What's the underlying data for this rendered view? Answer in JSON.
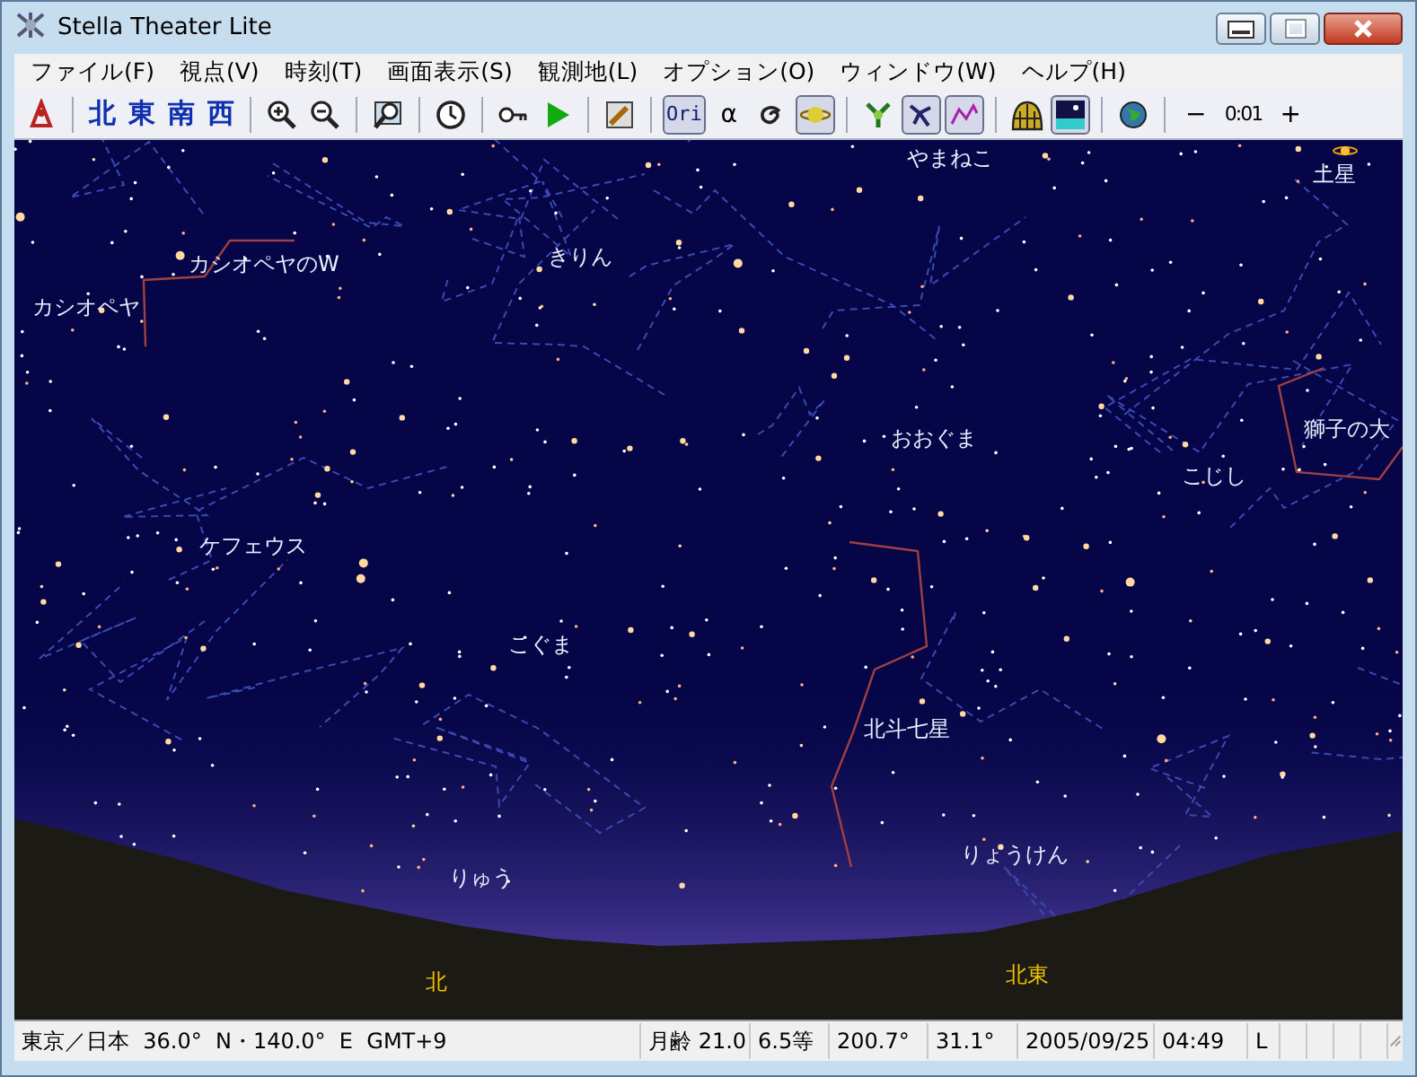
{
  "window": {
    "title": "Stella Theater Lite"
  },
  "menu": [
    "ファイル(F)",
    "視点(V)",
    "時刻(T)",
    "画面表示(S)",
    "観測地(L)",
    "オプション(O)",
    "ウィンドウ(W)",
    "ヘルプ(H)"
  ],
  "toolbar": [
    [
      {
        "kind": "tool",
        "pressed": false
      }
    ],
    [
      {
        "kind": "text",
        "label": "北",
        "pressed": false
      },
      {
        "kind": "text",
        "label": "東",
        "pressed": false
      },
      {
        "kind": "text",
        "label": "南",
        "pressed": false
      },
      {
        "kind": "text",
        "label": "西",
        "pressed": false
      }
    ],
    [
      {
        "kind": "tool",
        "pressed": false
      },
      {
        "kind": "tool",
        "pressed": false
      }
    ],
    [
      {
        "kind": "tool",
        "pressed": false
      }
    ],
    [
      {
        "kind": "tool",
        "pressed": false
      }
    ],
    [
      {
        "kind": "tool",
        "pressed": false
      },
      {
        "kind": "tool",
        "pressed": false
      }
    ],
    [
      {
        "kind": "tool",
        "pressed": false
      }
    ],
    [
      {
        "kind": "text",
        "label": "Ori",
        "pressed": true
      },
      {
        "kind": "text",
        "label": "α",
        "pressed": false
      },
      {
        "kind": "tool",
        "pressed": false
      },
      {
        "kind": "tool",
        "pressed": true
      }
    ],
    [
      {
        "kind": "tool",
        "pressed": false
      },
      {
        "kind": "tool",
        "pressed": true
      },
      {
        "kind": "tool",
        "pressed": true
      }
    ],
    [
      {
        "kind": "tool",
        "pressed": false
      },
      {
        "kind": "tool",
        "pressed": true
      }
    ],
    [
      {
        "kind": "tool",
        "pressed": false
      }
    ],
    [
      {
        "kind": "text",
        "label": "−",
        "pressed": false
      },
      {
        "kind": "readout",
        "label": "0:01"
      },
      {
        "kind": "text",
        "label": "+",
        "pressed": false
      }
    ]
  ],
  "sky": {
    "labels": [
      {
        "kind": "constellation",
        "text": "やまねこ"
      },
      {
        "kind": "planet",
        "text": "土星"
      },
      {
        "kind": "constellation",
        "text": "カシオペヤのW"
      },
      {
        "kind": "constellation",
        "text": "カシオペヤ"
      },
      {
        "kind": "constellation",
        "text": "きりん"
      },
      {
        "kind": "constellation",
        "text": "おおぐま"
      },
      {
        "kind": "constellation",
        "text": "こじし"
      },
      {
        "kind": "constellation",
        "text": "獅子の大"
      },
      {
        "kind": "constellation",
        "text": "ケフェウス"
      },
      {
        "kind": "constellation",
        "text": "こぐま"
      },
      {
        "kind": "constellation",
        "text": "北斗七星"
      },
      {
        "kind": "constellation",
        "text": "りゅう"
      },
      {
        "kind": "constellation",
        "text": "りょうけん"
      },
      {
        "kind": "direction",
        "text": "北"
      },
      {
        "kind": "direction",
        "text": "北東"
      }
    ]
  },
  "status_bar": [
    "東京／日本  36.0°  N・140.0°  E  GMT+9",
    "月齢 21.0",
    "6.5等",
    "200.7°",
    "31.1°",
    "2005/09/25",
    "04:49",
    "L"
  ]
}
